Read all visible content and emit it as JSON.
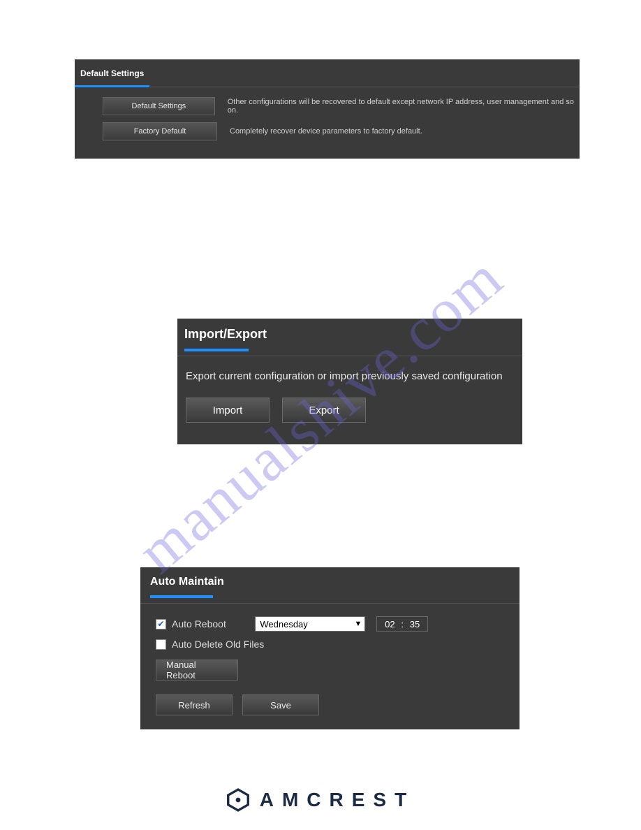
{
  "watermark": "manualshive.com",
  "panel1": {
    "tab_label": "Default Settings",
    "rows": [
      {
        "button": "Default Settings",
        "desc": "Other configurations will be recovered to default except network IP address, user management and so on."
      },
      {
        "button": "Factory Default",
        "desc": "Completely recover device parameters to factory default."
      }
    ]
  },
  "panel2": {
    "title": "Import/Export",
    "desc": "Export current configuration or import previously saved configuration",
    "import_label": "Import",
    "export_label": "Export"
  },
  "panel3": {
    "title": "Auto Maintain",
    "auto_reboot_label": "Auto Reboot",
    "auto_reboot_checked": true,
    "day_selected": "Wednesday",
    "time_hour": "02",
    "time_sep": ":",
    "time_minute": "35",
    "auto_delete_label": "Auto Delete Old Files",
    "auto_delete_checked": false,
    "manual_reboot_label": "Manual Reboot",
    "refresh_label": "Refresh",
    "save_label": "Save"
  },
  "footer": {
    "brand": "AMCREST"
  }
}
